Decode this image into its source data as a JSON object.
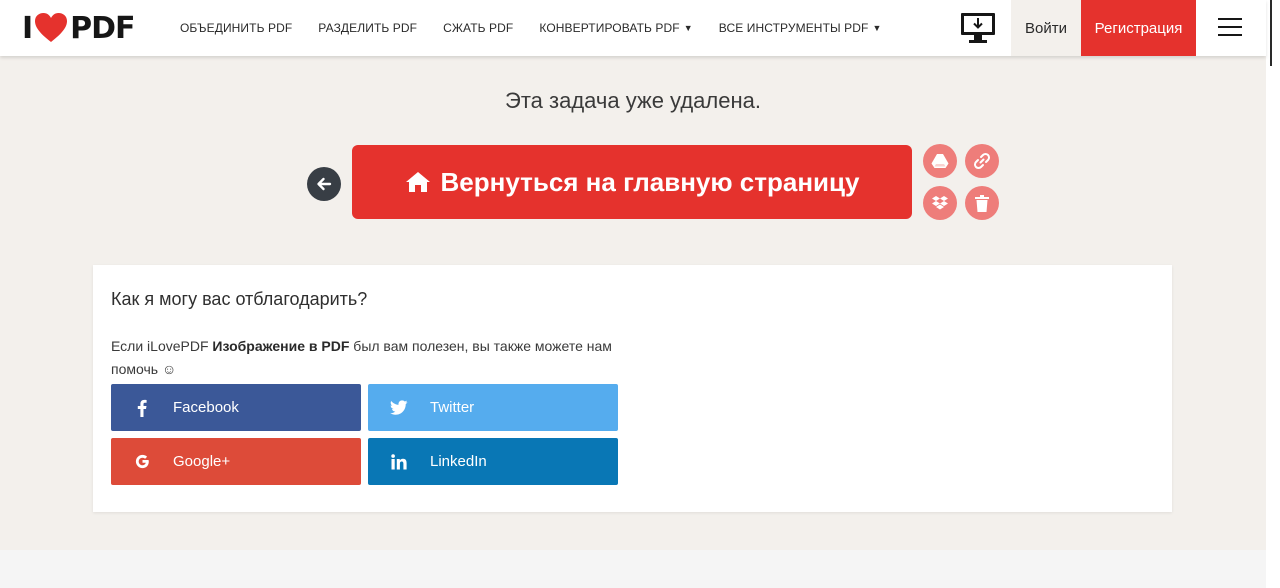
{
  "header": {
    "logo_left": "I",
    "logo_right": "PDF",
    "nav": [
      {
        "label": "ОБЪЕДИНИТЬ PDF"
      },
      {
        "label": "РАЗДЕЛИТЬ PDF"
      },
      {
        "label": "СЖАТЬ PDF"
      },
      {
        "label": "КОНВЕРТИРОВАТЬ PDF",
        "caret": "▼"
      },
      {
        "label": "ВСЕ ИНСТРУМЕНТЫ PDF",
        "caret": "▼"
      }
    ],
    "login_label": "Войти",
    "signup_label": "Регистрация"
  },
  "main": {
    "message": "Эта задача уже удалена.",
    "home_button_label": "Вернуться на главную страницу"
  },
  "thanks": {
    "title": "Как я могу вас отблагодарить?",
    "text_before": "Если iLovePDF ",
    "text_bold": "Изображение в PDF",
    "text_after": " был вам полезен, вы также можете нам помочь ☺",
    "buttons": {
      "facebook": "Facebook",
      "twitter": "Twitter",
      "google": "Google+",
      "linkedin": "LinkedIn"
    }
  },
  "colors": {
    "brand_red": "#e5322d",
    "facebook": "#3b5898",
    "twitter": "#55acee",
    "google": "#dd4b39",
    "linkedin": "#0977b5"
  }
}
